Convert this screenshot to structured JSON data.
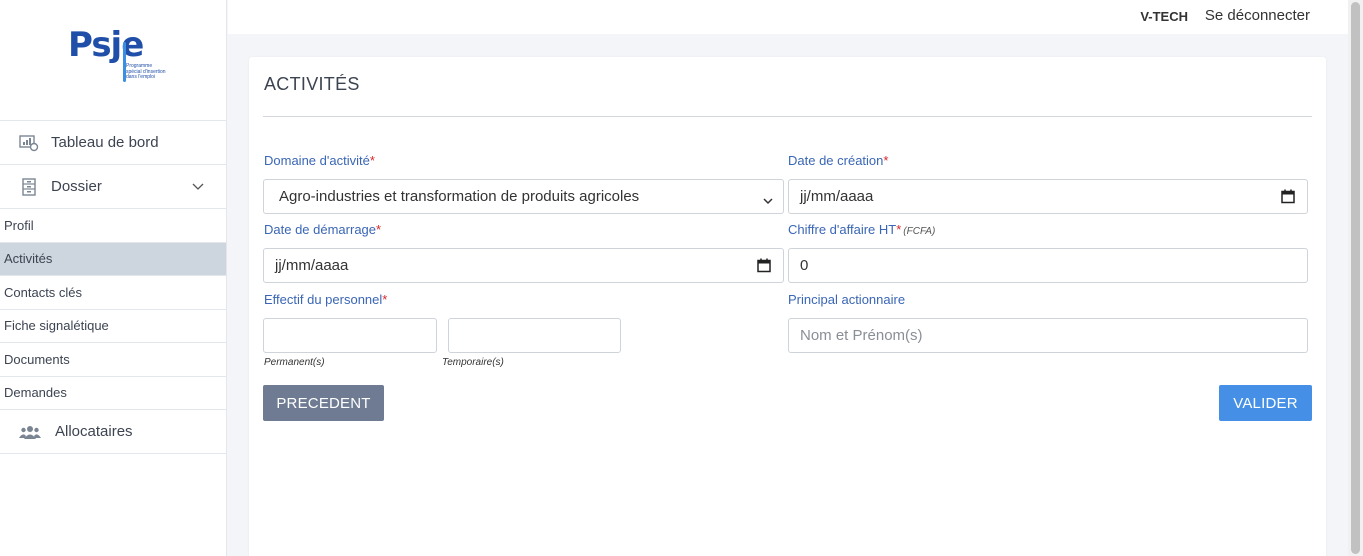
{
  "logo": {
    "text": "Psje",
    "tagline": "Programme spécial d'insertion dans l'emploi"
  },
  "topbar": {
    "user": "V-TECH",
    "logout": "Se déconnecter"
  },
  "sidebar": {
    "items": [
      {
        "label": "Tableau de bord"
      },
      {
        "label": "Dossier"
      },
      {
        "label": "Allocataires"
      }
    ],
    "subitems": [
      {
        "label": "Profil"
      },
      {
        "label": "Activités"
      },
      {
        "label": "Contacts clés"
      },
      {
        "label": "Fiche signalétique"
      },
      {
        "label": "Documents"
      },
      {
        "label": "Demandes"
      }
    ]
  },
  "form": {
    "title": "ACTIVITÉS",
    "domaine": {
      "label": "Domaine d'activité",
      "value": "Agro-industries et transformation de produits agricoles"
    },
    "date_creation": {
      "label": "Date de création",
      "value": "jj/mm/aaaa"
    },
    "date_demarrage": {
      "label": "Date de démarrage",
      "value": "jj/mm/aaaa"
    },
    "chiffre": {
      "label": "Chiffre d'affaire HT",
      "unit": "(FCFA)",
      "value": "0"
    },
    "effectif": {
      "label": "Effectif du personnel",
      "permanent_hint": "Permanent(s)",
      "temporaire_hint": "Temporaire(s)"
    },
    "actionnaire": {
      "label": "Principal actionnaire",
      "placeholder": "Nom et Prénom(s)"
    },
    "required_mark": "*",
    "prev_button": "PRECEDENT",
    "submit_button": "VALIDER"
  },
  "colors": {
    "accent": "#4590e6",
    "label": "#3a66b5",
    "required": "#d9262c",
    "active_bg": "#cdd5df"
  }
}
